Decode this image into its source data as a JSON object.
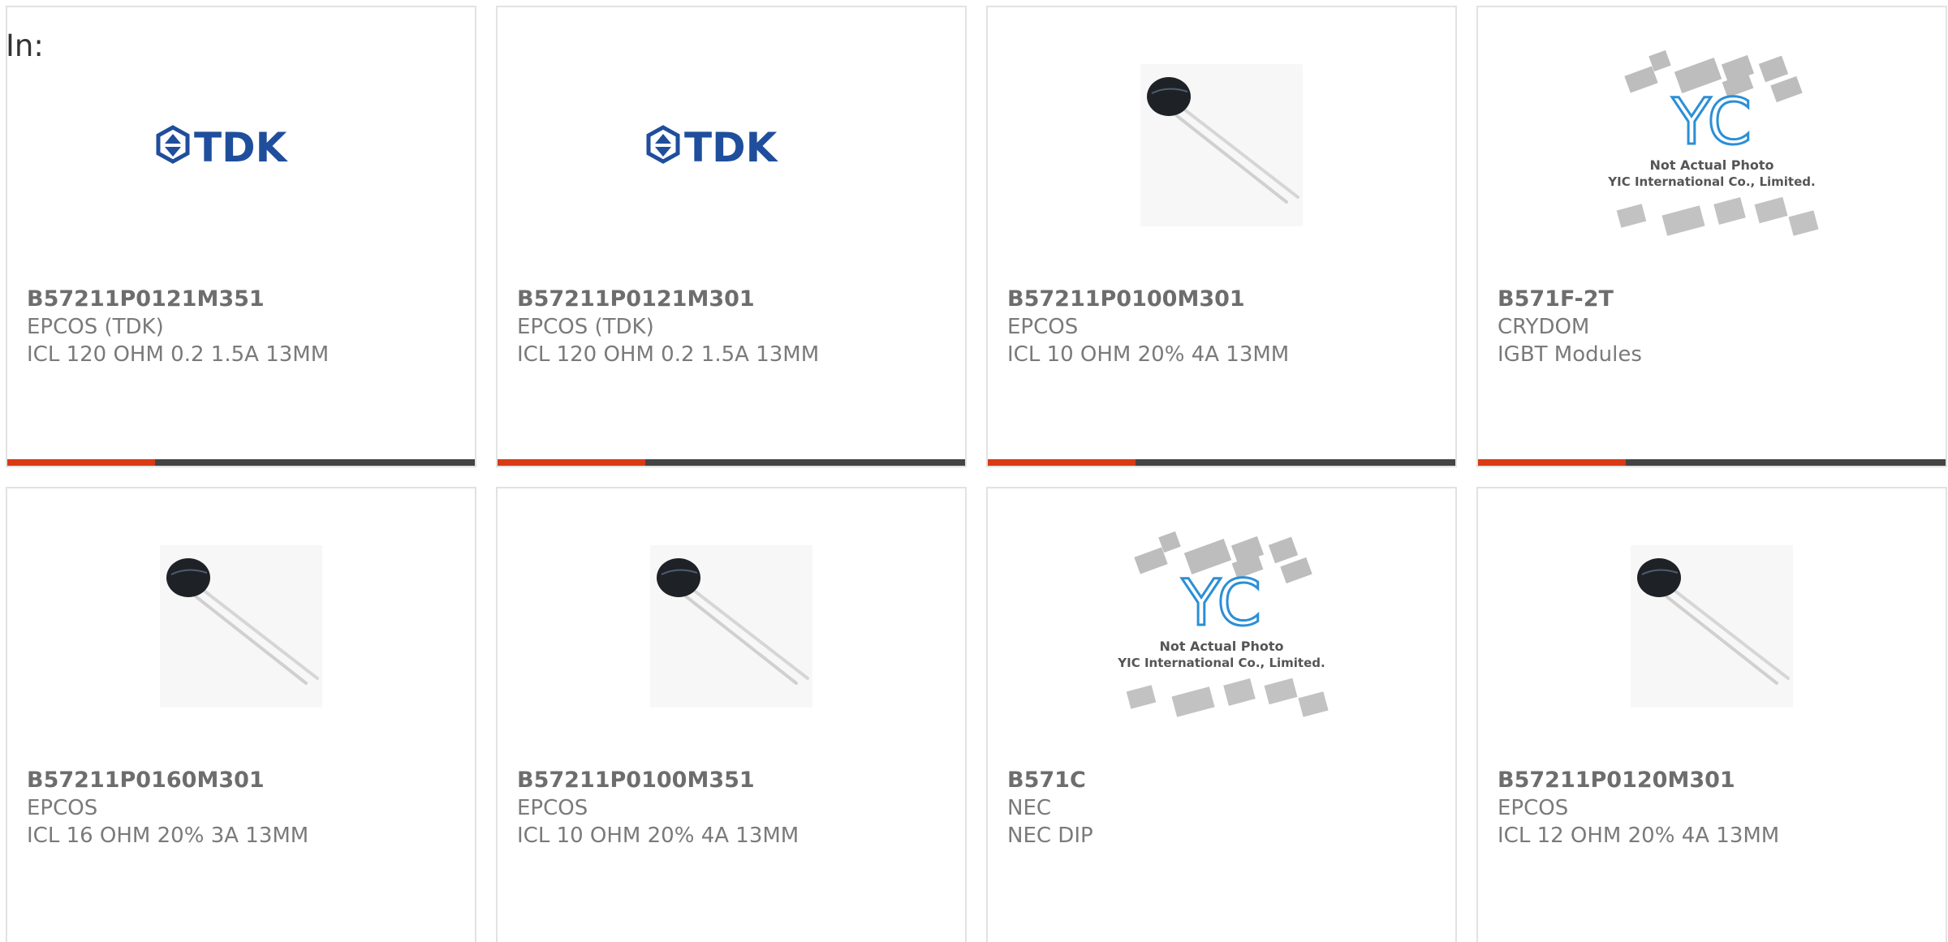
{
  "header": {
    "in_label": "In:"
  },
  "colors": {
    "accent": "#d93a14",
    "bar": "#444444"
  },
  "products": [
    {
      "part_number": "B57211P0121M351",
      "manufacturer": "EPCOS (TDK)",
      "description": "ICL 120 OHM 0.2 1.5A 13MM",
      "image": "tdk-logo",
      "logo_text": "TDK"
    },
    {
      "part_number": "B57211P0121M301",
      "manufacturer": "EPCOS (TDK)",
      "description": "ICL 120 OHM 0.2 1.5A 13MM",
      "image": "tdk-logo",
      "logo_text": "TDK"
    },
    {
      "part_number": "B57211P0100M301",
      "manufacturer": "EPCOS",
      "description": "ICL 10 OHM 20% 4A 13MM",
      "image": "thermistor"
    },
    {
      "part_number": "B571F-2T",
      "manufacturer": "CRYDOM",
      "description": "IGBT Modules",
      "image": "yic-placeholder",
      "placeholder_line1": "Not Actual Photo",
      "placeholder_line2": "YIC International Co., Limited."
    },
    {
      "part_number": "B57211P0160M301",
      "manufacturer": "EPCOS",
      "description": "ICL 16 OHM 20% 3A 13MM",
      "image": "thermistor"
    },
    {
      "part_number": "B57211P0100M351",
      "manufacturer": "EPCOS",
      "description": "ICL 10 OHM 20% 4A 13MM",
      "image": "thermistor"
    },
    {
      "part_number": "B571C",
      "manufacturer": "NEC",
      "description": "NEC DIP",
      "image": "yic-placeholder",
      "placeholder_line1": "Not Actual Photo",
      "placeholder_line2": "YIC International Co., Limited."
    },
    {
      "part_number": "B57211P0120M301",
      "manufacturer": "EPCOS",
      "description": "ICL 12 OHM 20% 4A 13MM",
      "image": "thermistor"
    }
  ]
}
